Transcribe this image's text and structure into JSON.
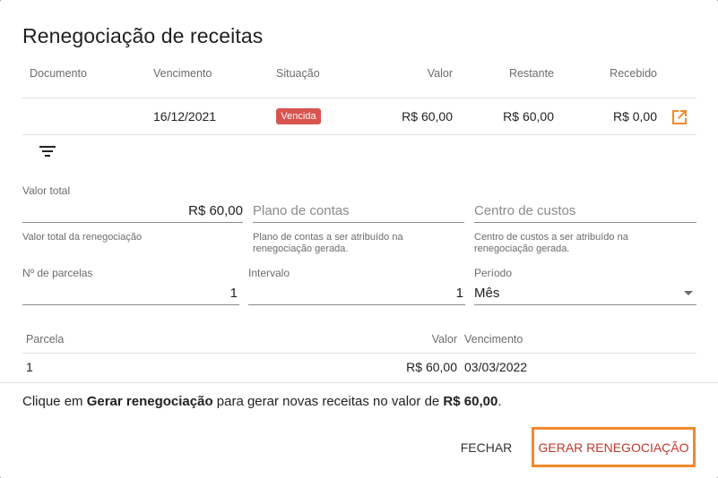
{
  "dialog": {
    "title": "Renegociação de receitas"
  },
  "receipts_table": {
    "columns": [
      "Documento",
      "Vencimento",
      "Situação",
      "Valor",
      "Restante",
      "Recebido"
    ],
    "rows": [
      {
        "documento": "",
        "vencimento": "16/12/2021",
        "situacao": "Vencida",
        "valor": "R$ 60,00",
        "restante": "R$ 60,00",
        "recebido": "R$ 0,00"
      }
    ],
    "badge_color": "#d9534f",
    "icons": {
      "open": "open-in-new-icon",
      "filter": "filter-icon"
    }
  },
  "form": {
    "valor_total": {
      "label": "Valor total",
      "value": "R$ 60,00",
      "hint": "Valor total da renegociação"
    },
    "plano_contas": {
      "placeholder": "Plano de contas",
      "hint_line1": "Plano de contas a ser atribuído na",
      "hint_line2": "renegociação gerada."
    },
    "centro_custos": {
      "placeholder": "Centro de custos",
      "hint_line1": "Centro de custos a ser atribuído na",
      "hint_line2": "renegociação gerada."
    },
    "parcelas": {
      "label": "Nº de parcelas",
      "value": "1"
    },
    "intervalo": {
      "label": "Intervalo",
      "value": "1"
    },
    "periodo": {
      "label": "Período",
      "value": "Mês"
    }
  },
  "installments_table": {
    "columns": [
      "Parcela",
      "Valor",
      "Vencimento"
    ],
    "rows": [
      {
        "parcela": "1",
        "valor": "R$ 60,00",
        "vencimento": "03/03/2022"
      }
    ]
  },
  "info": {
    "prefix": "Clique em ",
    "action": "Gerar renegociação",
    "middle": " para gerar novas receitas no valor de ",
    "amount": "R$ 60,00",
    "suffix": "."
  },
  "actions": {
    "close_label": "FECHAR",
    "generate_label": "GERAR RENEGOCIAÇÃO"
  },
  "colors": {
    "accent_red": "#c0392b",
    "highlight_orange": "#f18a2c",
    "icon_orange": "#f18a2c"
  }
}
